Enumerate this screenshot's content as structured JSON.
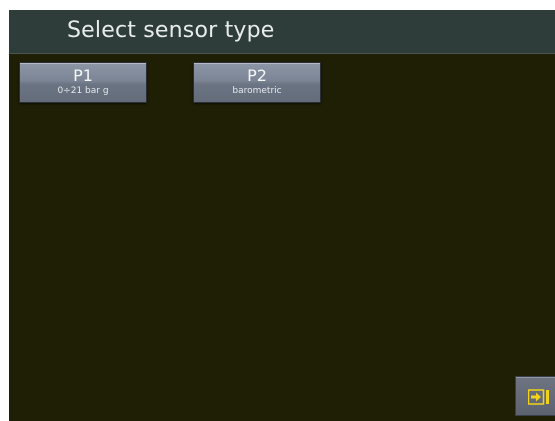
{
  "header": {
    "title": "Select sensor type"
  },
  "sensors": [
    {
      "name": "P1",
      "subtitle": "0÷21 bar g"
    },
    {
      "name": "P2",
      "subtitle": "barometric"
    }
  ],
  "footer": {
    "exit_icon": "exit-arrow-to-bar-icon"
  },
  "colors": {
    "background": "#1f1f05",
    "header": "#2e3d3a",
    "button": "#7c8595",
    "exit_icon": "#f2d21b"
  }
}
